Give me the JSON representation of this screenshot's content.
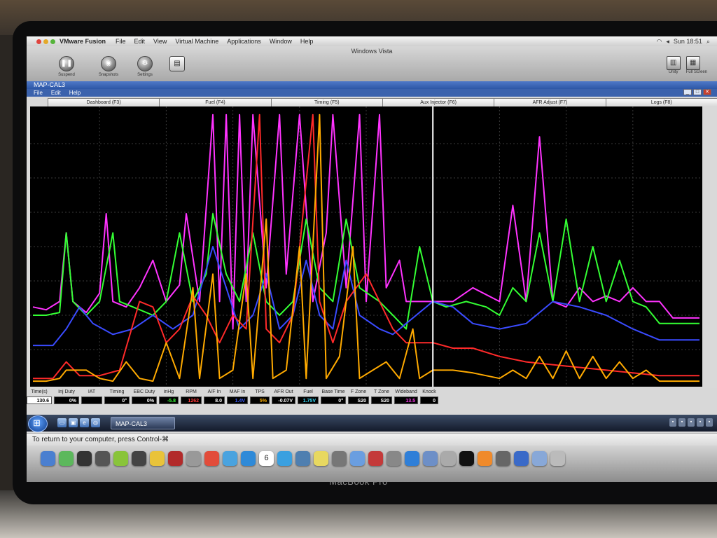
{
  "mac_menubar": {
    "app": "VMware Fusion",
    "items": [
      "File",
      "Edit",
      "View",
      "Virtual Machine",
      "Applications",
      "Window",
      "Help"
    ],
    "clock": "Sun 18:51"
  },
  "vm_toolbar": {
    "window_title": "Windows Vista",
    "buttons": [
      "Suspend",
      "Snapshots",
      "Settings"
    ],
    "right_buttons": [
      "Unity",
      "Full Screen"
    ]
  },
  "app_window": {
    "title": "MAP-CAL3",
    "menu": [
      "File",
      "Edit",
      "Help"
    ],
    "tabs": [
      "Dashboard (F3)",
      "Fuel (F4)",
      "Timing (F5)",
      "Aux Injector (F6)",
      "AFR Adjust (F7)",
      "Logs (F8)"
    ]
  },
  "readouts": [
    {
      "label": "Time(s)",
      "value": "130.6",
      "color": "#000000",
      "bg": "#ffffff"
    },
    {
      "label": "Inj Duty",
      "value": "0%",
      "color": "#ffffff",
      "bg": "#000000"
    },
    {
      "label": "IAT",
      "value": "",
      "color": "#ffffff",
      "bg": "#000000"
    },
    {
      "label": "Timing",
      "value": "0°",
      "color": "#ffffff",
      "bg": "#000000"
    },
    {
      "label": "EBC Duty",
      "value": "0%",
      "color": "#ffffff",
      "bg": "#000000"
    },
    {
      "label": "inHg",
      "value": "-5.8",
      "color": "#38ff38",
      "bg": "#000000"
    },
    {
      "label": "RPM",
      "value": "1262",
      "color": "#ff3a3a",
      "bg": "#000000"
    },
    {
      "label": "A/F In",
      "value": "8.0",
      "color": "#ffffff",
      "bg": "#000000"
    },
    {
      "label": "MAF In",
      "value": "1.4V",
      "color": "#3a5cff",
      "bg": "#000000"
    },
    {
      "label": "TPS",
      "value": "5%",
      "color": "#ffb000",
      "bg": "#000000"
    },
    {
      "label": "AFR Out",
      "value": "-0.07V",
      "color": "#ffffff",
      "bg": "#000000"
    },
    {
      "label": "Fuel",
      "value": "1.75V",
      "color": "#38e0ff",
      "bg": "#000000"
    },
    {
      "label": "Base Time",
      "value": "0°",
      "color": "#ffffff",
      "bg": "#000000"
    },
    {
      "label": "F Zone",
      "value": "S20",
      "color": "#ffffff",
      "bg": "#000000"
    },
    {
      "label": "T Zone",
      "value": "S20",
      "color": "#ffffff",
      "bg": "#000000"
    },
    {
      "label": "Wideband",
      "value": "13.5",
      "color": "#ff3af0",
      "bg": "#000000"
    },
    {
      "label": "Knock",
      "value": "0",
      "color": "#ffffff",
      "bg": "#000000"
    }
  ],
  "taskbar": {
    "task_label": "MAP-CAL3"
  },
  "notice": {
    "text": "To return to your computer, press Control-⌘"
  },
  "dock": {
    "icons": [
      "finder-icon",
      "android-file-icon",
      "activity-monitor-icon",
      "time-machine-icon",
      "android-icon",
      "console-icon",
      "cyberduck-icon",
      "dictionary-icon",
      "iphone-config-icon",
      "chrome-icon",
      "preview-icon",
      "safari-icon",
      "calendar-icon",
      "ichat-icon",
      "iphoto-icon",
      "stickies-icon",
      "image-capture-icon",
      "itunes-icon",
      "photo-booth-icon",
      "preferences-icon",
      "app-store-icon",
      "mail-icon",
      "disk-utility-icon",
      "terminal-icon",
      "vlc-icon",
      "calculator-icon",
      "network-icon",
      "folder-icon",
      "trash-icon"
    ],
    "calendar_day": "6"
  },
  "laptop_brand": "MacBook Pro",
  "chart_data": {
    "type": "line",
    "xlim": [
      0,
      1
    ],
    "ylim": [
      0,
      1
    ],
    "grid": true,
    "cursor_x": 0.6,
    "series": [
      {
        "color": "#ff33ff",
        "points": [
          [
            0,
            0.28
          ],
          [
            0.02,
            0.27
          ],
          [
            0.04,
            0.3
          ],
          [
            0.05,
            0.55
          ],
          [
            0.06,
            0.3
          ],
          [
            0.08,
            0.26
          ],
          [
            0.1,
            0.33
          ],
          [
            0.11,
            0.62
          ],
          [
            0.12,
            0.3
          ],
          [
            0.14,
            0.28
          ],
          [
            0.16,
            0.35
          ],
          [
            0.18,
            0.45
          ],
          [
            0.2,
            0.3
          ],
          [
            0.22,
            0.36
          ],
          [
            0.23,
            0.62
          ],
          [
            0.25,
            0.3
          ],
          [
            0.27,
            0.98
          ],
          [
            0.28,
            0.3
          ],
          [
            0.29,
            0.98
          ],
          [
            0.3,
            0.2
          ],
          [
            0.31,
            0.98
          ],
          [
            0.32,
            0.3
          ],
          [
            0.33,
            0.98
          ],
          [
            0.35,
            0.35
          ],
          [
            0.37,
            0.98
          ],
          [
            0.38,
            0.4
          ],
          [
            0.4,
            0.98
          ],
          [
            0.42,
            0.3
          ],
          [
            0.44,
            0.55
          ],
          [
            0.45,
            0.98
          ],
          [
            0.47,
            0.35
          ],
          [
            0.49,
            0.98
          ],
          [
            0.5,
            0.3
          ],
          [
            0.52,
            0.98
          ],
          [
            0.53,
            0.35
          ],
          [
            0.55,
            0.45
          ],
          [
            0.56,
            0.3
          ],
          [
            0.58,
            0.3
          ],
          [
            0.6,
            0.3
          ],
          [
            0.63,
            0.3
          ],
          [
            0.66,
            0.35
          ],
          [
            0.7,
            0.3
          ],
          [
            0.72,
            0.65
          ],
          [
            0.74,
            0.3
          ],
          [
            0.76,
            0.9
          ],
          [
            0.78,
            0.3
          ],
          [
            0.8,
            0.28
          ],
          [
            0.82,
            0.35
          ],
          [
            0.84,
            0.3
          ],
          [
            0.86,
            0.32
          ],
          [
            0.88,
            0.3
          ],
          [
            0.9,
            0.35
          ],
          [
            0.92,
            0.3
          ],
          [
            0.94,
            0.3
          ],
          [
            0.96,
            0.24
          ],
          [
            1,
            0.24
          ]
        ]
      },
      {
        "color": "#33ff33",
        "points": [
          [
            0,
            0.25
          ],
          [
            0.02,
            0.25
          ],
          [
            0.04,
            0.26
          ],
          [
            0.05,
            0.55
          ],
          [
            0.06,
            0.3
          ],
          [
            0.08,
            0.25
          ],
          [
            0.1,
            0.3
          ],
          [
            0.12,
            0.55
          ],
          [
            0.13,
            0.3
          ],
          [
            0.15,
            0.28
          ],
          [
            0.18,
            0.25
          ],
          [
            0.2,
            0.3
          ],
          [
            0.22,
            0.55
          ],
          [
            0.24,
            0.3
          ],
          [
            0.26,
            0.4
          ],
          [
            0.27,
            0.62
          ],
          [
            0.29,
            0.4
          ],
          [
            0.31,
            0.3
          ],
          [
            0.33,
            0.55
          ],
          [
            0.35,
            0.3
          ],
          [
            0.37,
            0.25
          ],
          [
            0.39,
            0.3
          ],
          [
            0.41,
            0.6
          ],
          [
            0.43,
            0.35
          ],
          [
            0.45,
            0.3
          ],
          [
            0.47,
            0.6
          ],
          [
            0.49,
            0.35
          ],
          [
            0.52,
            0.3
          ],
          [
            0.54,
            0.25
          ],
          [
            0.56,
            0.2
          ],
          [
            0.58,
            0.5
          ],
          [
            0.6,
            0.3
          ],
          [
            0.62,
            0.28
          ],
          [
            0.65,
            0.3
          ],
          [
            0.68,
            0.28
          ],
          [
            0.7,
            0.25
          ],
          [
            0.72,
            0.35
          ],
          [
            0.74,
            0.3
          ],
          [
            0.76,
            0.55
          ],
          [
            0.78,
            0.3
          ],
          [
            0.8,
            0.6
          ],
          [
            0.82,
            0.3
          ],
          [
            0.84,
            0.5
          ],
          [
            0.86,
            0.3
          ],
          [
            0.88,
            0.45
          ],
          [
            0.9,
            0.3
          ],
          [
            0.92,
            0.28
          ],
          [
            0.94,
            0.22
          ],
          [
            1,
            0.22
          ]
        ]
      },
      {
        "color": "#3a4bff",
        "points": [
          [
            0,
            0.14
          ],
          [
            0.03,
            0.14
          ],
          [
            0.05,
            0.2
          ],
          [
            0.07,
            0.28
          ],
          [
            0.09,
            0.22
          ],
          [
            0.12,
            0.18
          ],
          [
            0.15,
            0.2
          ],
          [
            0.18,
            0.25
          ],
          [
            0.21,
            0.2
          ],
          [
            0.24,
            0.25
          ],
          [
            0.27,
            0.5
          ],
          [
            0.29,
            0.35
          ],
          [
            0.31,
            0.2
          ],
          [
            0.33,
            0.25
          ],
          [
            0.35,
            0.4
          ],
          [
            0.37,
            0.2
          ],
          [
            0.39,
            0.25
          ],
          [
            0.41,
            0.45
          ],
          [
            0.43,
            0.25
          ],
          [
            0.45,
            0.2
          ],
          [
            0.47,
            0.45
          ],
          [
            0.49,
            0.25
          ],
          [
            0.52,
            0.2
          ],
          [
            0.54,
            0.18
          ],
          [
            0.56,
            0.22
          ],
          [
            0.6,
            0.3
          ],
          [
            0.63,
            0.28
          ],
          [
            0.66,
            0.22
          ],
          [
            0.7,
            0.2
          ],
          [
            0.74,
            0.22
          ],
          [
            0.78,
            0.3
          ],
          [
            0.82,
            0.28
          ],
          [
            0.86,
            0.25
          ],
          [
            0.9,
            0.2
          ],
          [
            0.94,
            0.16
          ],
          [
            1,
            0.16
          ]
        ]
      },
      {
        "color": "#ff2a2a",
        "points": [
          [
            0,
            0.02
          ],
          [
            0.03,
            0.02
          ],
          [
            0.05,
            0.08
          ],
          [
            0.07,
            0.03
          ],
          [
            0.1,
            0.03
          ],
          [
            0.13,
            0.05
          ],
          [
            0.16,
            0.3
          ],
          [
            0.18,
            0.28
          ],
          [
            0.2,
            0.15
          ],
          [
            0.22,
            0.2
          ],
          [
            0.24,
            0.32
          ],
          [
            0.26,
            0.25
          ],
          [
            0.28,
            0.15
          ],
          [
            0.3,
            0.25
          ],
          [
            0.32,
            0.2
          ],
          [
            0.34,
            0.98
          ],
          [
            0.35,
            0.2
          ],
          [
            0.37,
            0.15
          ],
          [
            0.39,
            0.25
          ],
          [
            0.42,
            0.98
          ],
          [
            0.43,
            0.3
          ],
          [
            0.45,
            0.15
          ],
          [
            0.47,
            0.3
          ],
          [
            0.5,
            0.4
          ],
          [
            0.52,
            0.3
          ],
          [
            0.54,
            0.2
          ],
          [
            0.56,
            0.15
          ],
          [
            0.6,
            0.15
          ],
          [
            0.63,
            0.13
          ],
          [
            0.66,
            0.13
          ],
          [
            0.7,
            0.1
          ],
          [
            0.74,
            0.08
          ],
          [
            0.78,
            0.07
          ],
          [
            0.82,
            0.06
          ],
          [
            0.86,
            0.05
          ],
          [
            0.9,
            0.04
          ],
          [
            0.94,
            0.03
          ],
          [
            1,
            0.03
          ]
        ]
      },
      {
        "color": "#ffaa00",
        "points": [
          [
            0,
            0.01
          ],
          [
            0.02,
            0.01
          ],
          [
            0.04,
            0.02
          ],
          [
            0.05,
            0.05
          ],
          [
            0.08,
            0.05
          ],
          [
            0.1,
            0.02
          ],
          [
            0.12,
            0.01
          ],
          [
            0.14,
            0.08
          ],
          [
            0.16,
            0.02
          ],
          [
            0.18,
            0.01
          ],
          [
            0.2,
            0.15
          ],
          [
            0.22,
            0.02
          ],
          [
            0.24,
            0.35
          ],
          [
            0.25,
            0.02
          ],
          [
            0.27,
            0.4
          ],
          [
            0.28,
            0.02
          ],
          [
            0.3,
            0.05
          ],
          [
            0.32,
            0.4
          ],
          [
            0.33,
            0.02
          ],
          [
            0.35,
            0.6
          ],
          [
            0.36,
            0.02
          ],
          [
            0.38,
            0.05
          ],
          [
            0.4,
            0.5
          ],
          [
            0.41,
            0.02
          ],
          [
            0.43,
            0.98
          ],
          [
            0.44,
            0.02
          ],
          [
            0.46,
            0.1
          ],
          [
            0.48,
            0.5
          ],
          [
            0.49,
            0.02
          ],
          [
            0.51,
            0.05
          ],
          [
            0.53,
            0.08
          ],
          [
            0.55,
            0.02
          ],
          [
            0.57,
            0.2
          ],
          [
            0.58,
            0.02
          ],
          [
            0.6,
            0.05
          ],
          [
            0.63,
            0.05
          ],
          [
            0.66,
            0.04
          ],
          [
            0.7,
            0.02
          ],
          [
            0.72,
            0.05
          ],
          [
            0.74,
            0.02
          ],
          [
            0.76,
            0.1
          ],
          [
            0.78,
            0.02
          ],
          [
            0.8,
            0.12
          ],
          [
            0.82,
            0.02
          ],
          [
            0.84,
            0.1
          ],
          [
            0.86,
            0.02
          ],
          [
            0.88,
            0.08
          ],
          [
            0.9,
            0.02
          ],
          [
            0.92,
            0.05
          ],
          [
            0.94,
            0.01
          ],
          [
            1,
            0.01
          ]
        ]
      }
    ]
  }
}
